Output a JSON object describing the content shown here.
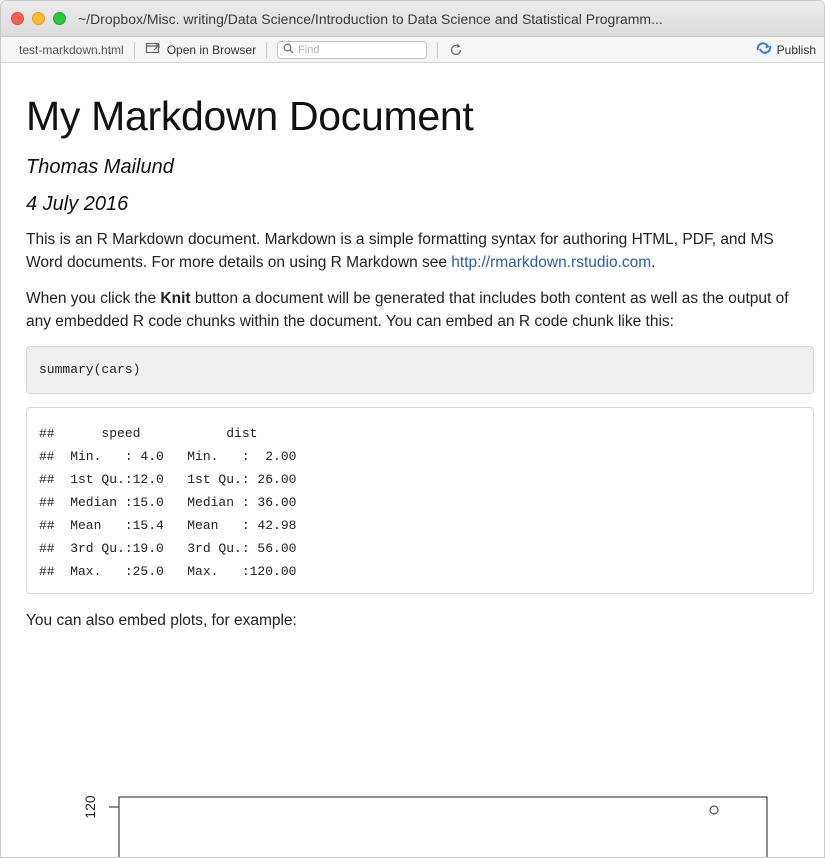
{
  "window": {
    "title": "~/Dropbox/Misc. writing/Data Science/Introduction to Data Science and Statistical Programm..."
  },
  "toolbar": {
    "file_name": "test-markdown.html",
    "open_in_browser": "Open in Browser",
    "find_placeholder": "Find",
    "publish": "Publish"
  },
  "document": {
    "title": "My Markdown Document",
    "author": "Thomas Mailund",
    "date": "4 July 2016",
    "p1_text": "This is an R Markdown document. Markdown is a simple formatting syntax for authoring HTML, PDF, and MS Word documents. For more details on using R Markdown see ",
    "p1_link": "http://rmarkdown.rstudio.com",
    "p1_end": ".",
    "p2_before": "When you click the ",
    "p2_bold": "Knit",
    "p2_after": " button a document will be generated that includes both content as well as the output of any embedded R code chunks within the document. You can embed an R code chunk like this:",
    "code_input": "summary(cars)",
    "code_output": [
      "##      speed           dist       ",
      "##  Min.   : 4.0   Min.   :  2.00  ",
      "##  1st Qu.:12.0   1st Qu.: 26.00  ",
      "##  Median :15.0   Median : 36.00  ",
      "##  Mean   :15.4   Mean   : 42.98  ",
      "##  3rd Qu.:19.0   3rd Qu.: 56.00  ",
      "##  Max.   :25.0   Max.   :120.00  "
    ],
    "p3": "You can also embed plots, for example:",
    "plot_tick_label": "120"
  }
}
